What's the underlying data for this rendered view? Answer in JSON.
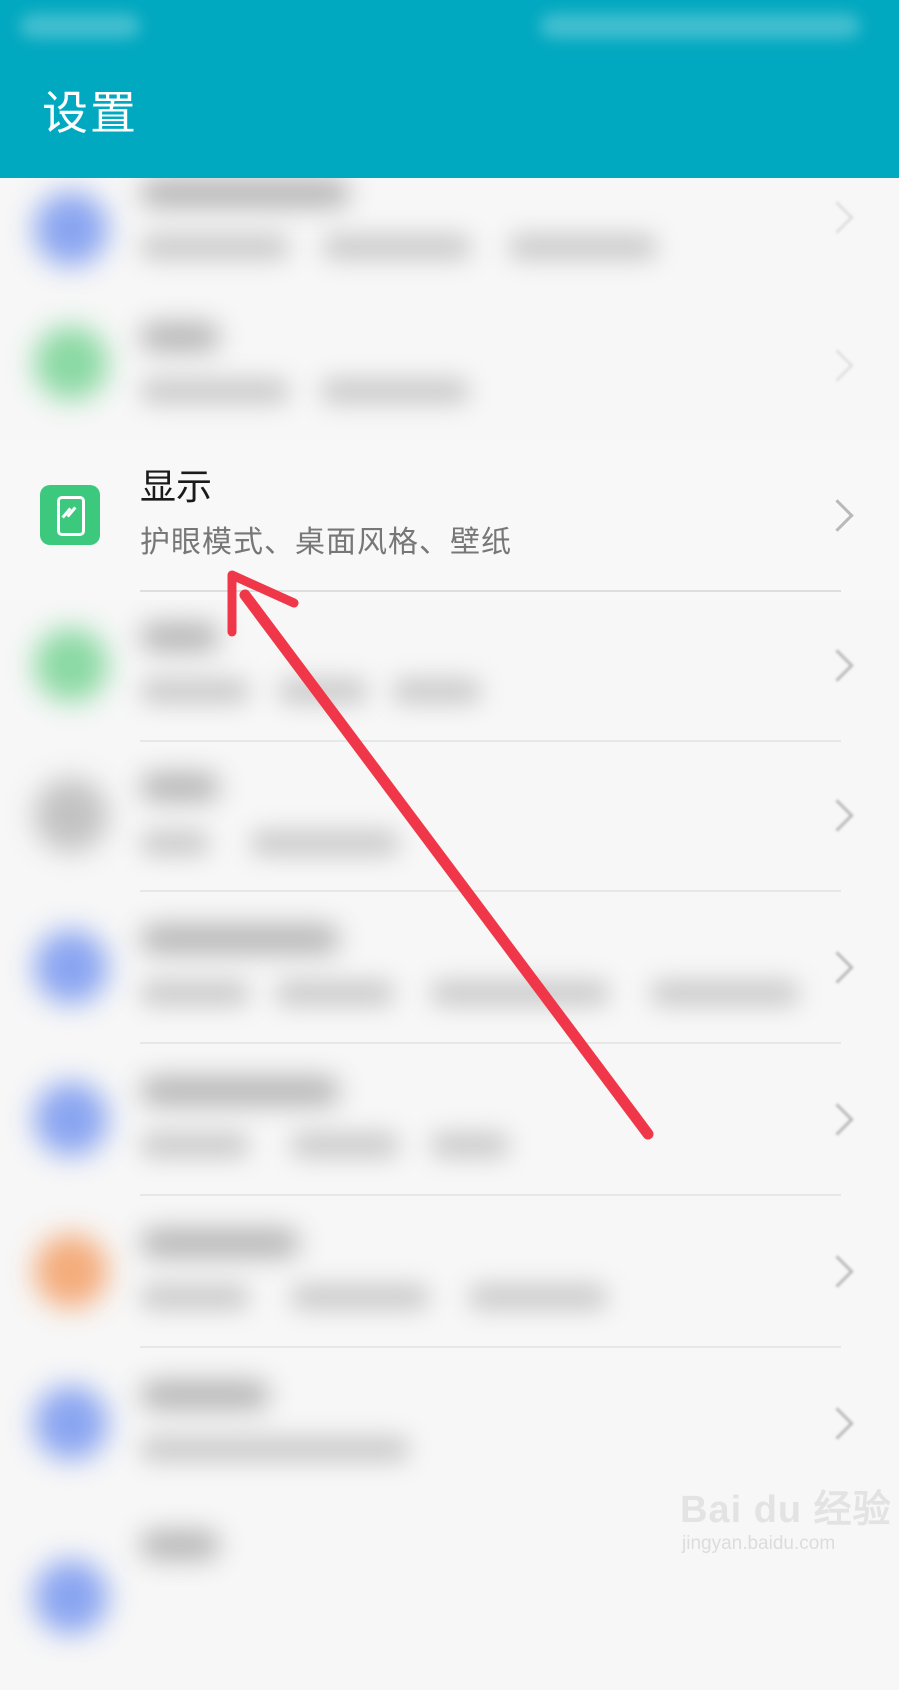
{
  "app_bar": {
    "title": "设置",
    "color": "#00a8c0"
  },
  "display_item": {
    "title": "显示",
    "subtitle": "护眼模式、桌面风格、壁纸",
    "icon": "display-phone-icon",
    "icon_color": "#3cc97d"
  },
  "blurred_rows": [
    {
      "icon_color": "#7e9cf0"
    },
    {
      "icon_color": "#7fd69a"
    },
    {
      "icon_color": "#7fd69a"
    },
    {
      "icon_color": "#bdbdbd"
    },
    {
      "icon_color": "#7e9cf0"
    },
    {
      "icon_color": "#7e9cf0"
    },
    {
      "icon_color": "#f4a46e"
    },
    {
      "icon_color": "#7e9cf0"
    },
    {
      "icon_color": "#7e9cf0"
    }
  ],
  "annotation": {
    "arrow_color": "#f0374a"
  },
  "watermark": {
    "logo": "Bai du 经验",
    "url": "jingyan.baidu.com"
  }
}
